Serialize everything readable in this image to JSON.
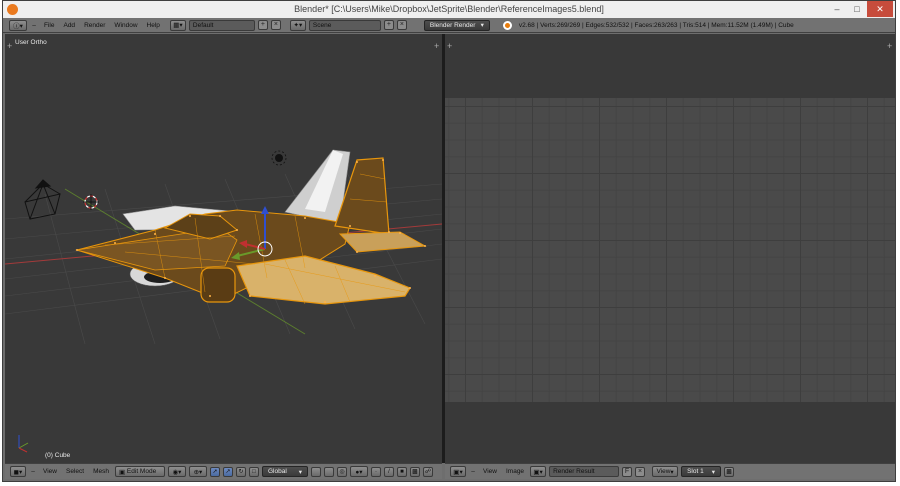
{
  "window": {
    "title": "Blender* [C:\\Users\\Mike\\Dropbox\\JetSprite\\Blender\\ReferenceImages5.blend]",
    "controls": [
      "–",
      "□",
      "✕"
    ]
  },
  "info_header": {
    "menus": [
      "File",
      "Add",
      "Render",
      "Window",
      "Help"
    ],
    "screen_layout": "Default",
    "scene": "Scene",
    "render_engine": "Blender Render",
    "stats": "v2.68 | Verts:269/269 | Edges:532/532 | Faces:263/263 | Tris:514 | Mem:11.52M (1.49M) | Cube"
  },
  "viewport": {
    "view_label": "User Ortho",
    "object_label": "(0) Cube",
    "header": {
      "menus": [
        "View",
        "Select",
        "Mesh"
      ],
      "mode": "Edit Mode",
      "orientation": "Global"
    }
  },
  "image_editor": {
    "header": {
      "menus": [
        "View",
        "Image"
      ],
      "image_name": "Render Result",
      "fake_user": "F",
      "view_mode": "View",
      "slot": "Slot 1"
    }
  },
  "colors": {
    "selection": "#e8960c",
    "x_axis": "#a33a3a",
    "y_axis": "#6a9a2a",
    "z_axis": "#2f4fd0",
    "viewport_bg": "#393939"
  }
}
